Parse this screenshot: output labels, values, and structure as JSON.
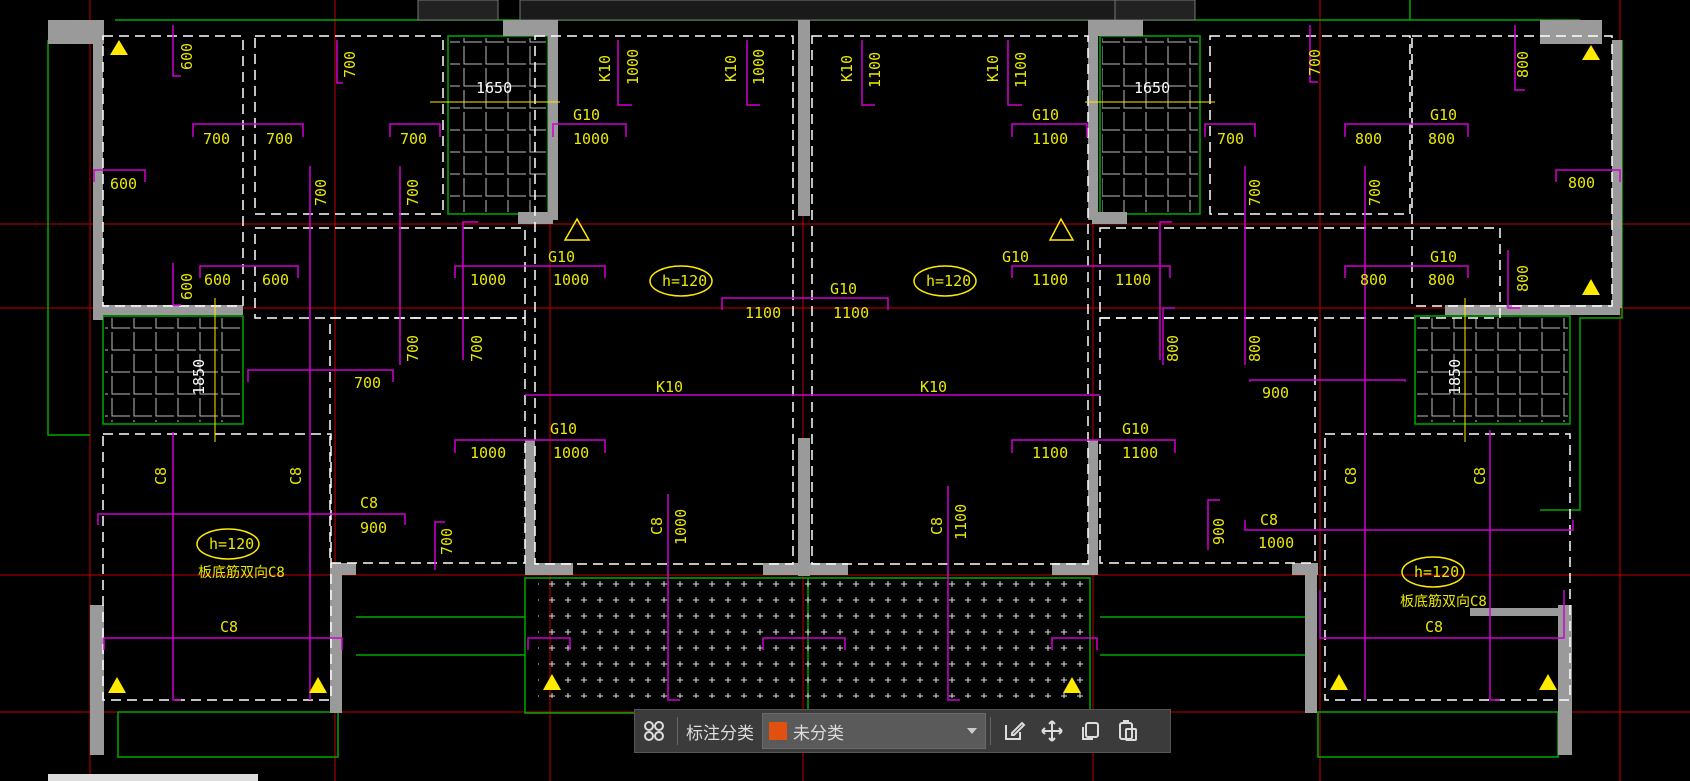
{
  "drawing": {
    "room_slab_tags": [
      "h=120",
      "h=120",
      "h=120",
      "h=120"
    ],
    "slab_notes": [
      "板底筋双向C8",
      "板底筋双向C8"
    ],
    "dims": {
      "d600a": "600",
      "d700a": "700",
      "d700b": "700",
      "d700c": "700",
      "d700d": "700",
      "d600b": "600",
      "d1650a": "1650",
      "d1650b": "1650",
      "dk10a": "K10",
      "dk10b": "K10",
      "dk10c": "K10",
      "dk10d": "K10",
      "d1000v1": "1000",
      "d1000v2": "1000",
      "d1100v1": "1100",
      "d1100v2": "1100",
      "g10a": "G10",
      "g10b": "G10",
      "g10c": "G10",
      "g10d": "G10",
      "g10e": "G10",
      "g10f": "G10",
      "g10g": "G10",
      "d1000a": "1000",
      "d1100a": "1100",
      "d700e": "700",
      "d800a": "800",
      "d800b": "800",
      "d800c": "800",
      "d700v1": "700",
      "d700v2": "700",
      "d700v3": "700",
      "d700v4": "700",
      "d700v5": "700",
      "d700v6": "700",
      "d600c": "600",
      "d600d": "600",
      "d600e": "600",
      "d1000b": "1000",
      "d1000c": "1000",
      "d1100b": "1100",
      "d1100c": "1100",
      "d800d": "800",
      "d800e": "800",
      "d800f": "800",
      "d1100d": "1100",
      "d1100e": "1100",
      "d1850a": "1850",
      "d1850b": "1850",
      "d700f": "700",
      "d800g": "800",
      "d800h": "800",
      "d900a": "900",
      "k10h1": "K10",
      "k10h2": "K10",
      "d1000d": "1000",
      "d1000e": "1000",
      "d1100f": "1100",
      "d1100g": "1100",
      "c8a": "C8",
      "c8b": "C8",
      "c8c": "C8",
      "c8d": "C8",
      "c8e": "C8",
      "c8f": "C8",
      "c8g": "C8",
      "c8h": "C8",
      "d900b": "900",
      "d700g": "700",
      "d1000f": "1000",
      "d1100h": "1100",
      "d900c": "900",
      "d1000g": "1000"
    }
  },
  "toolbar": {
    "group_icon": "grid-4-icon",
    "label": "标注分类",
    "select_value": "未分类",
    "select_color": "#e0500f",
    "actions": [
      "edit-icon",
      "move-icon",
      "copy-icon",
      "paste-icon"
    ]
  },
  "colors": {
    "wall": "#9a9a9a",
    "dim": "#d000d0",
    "text": "#e8e800",
    "axis": "#d00000",
    "line": "#00b000",
    "dash": "#ffffff"
  }
}
